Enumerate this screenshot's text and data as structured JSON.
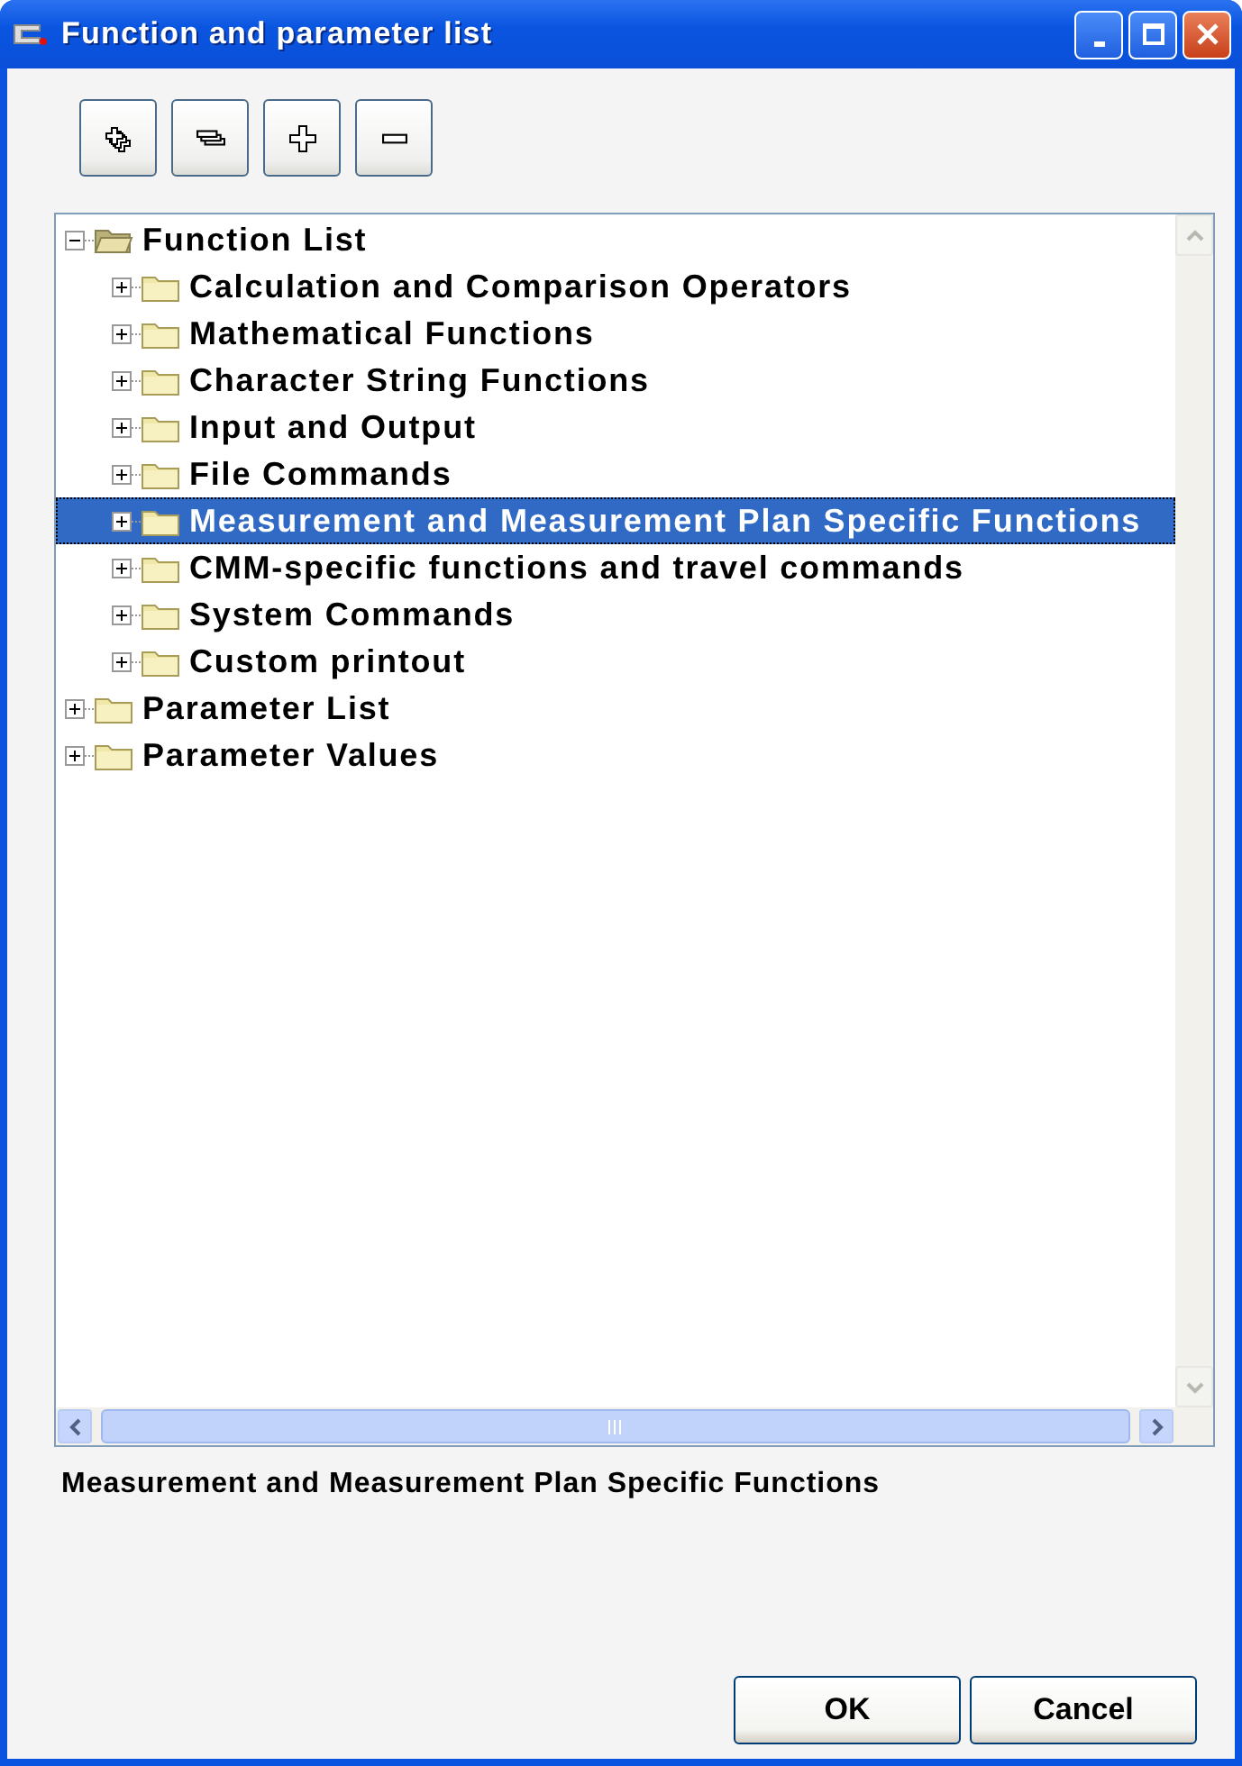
{
  "window": {
    "title": "Function and parameter list"
  },
  "tree": [
    {
      "label": "Function List",
      "expanded": true,
      "selected": false,
      "children": [
        {
          "label": "Calculation and Comparison Operators",
          "expanded": false,
          "selected": false
        },
        {
          "label": "Mathematical Functions",
          "expanded": false,
          "selected": false
        },
        {
          "label": "Character String Functions",
          "expanded": false,
          "selected": false
        },
        {
          "label": "Input and Output",
          "expanded": false,
          "selected": false
        },
        {
          "label": "File Commands",
          "expanded": false,
          "selected": false
        },
        {
          "label": "Measurement and Measurement Plan Specific Functions",
          "expanded": false,
          "selected": true
        },
        {
          "label": "CMM-specific functions and travel commands",
          "expanded": false,
          "selected": false
        },
        {
          "label": "System Commands",
          "expanded": false,
          "selected": false
        },
        {
          "label": "Custom printout",
          "expanded": false,
          "selected": false
        }
      ]
    },
    {
      "label": "Parameter List",
      "expanded": false,
      "selected": false
    },
    {
      "label": "Parameter Values",
      "expanded": false,
      "selected": false
    }
  ],
  "description": "Measurement and Measurement Plan Specific Functions",
  "buttons": [
    "OK",
    "Cancel"
  ]
}
